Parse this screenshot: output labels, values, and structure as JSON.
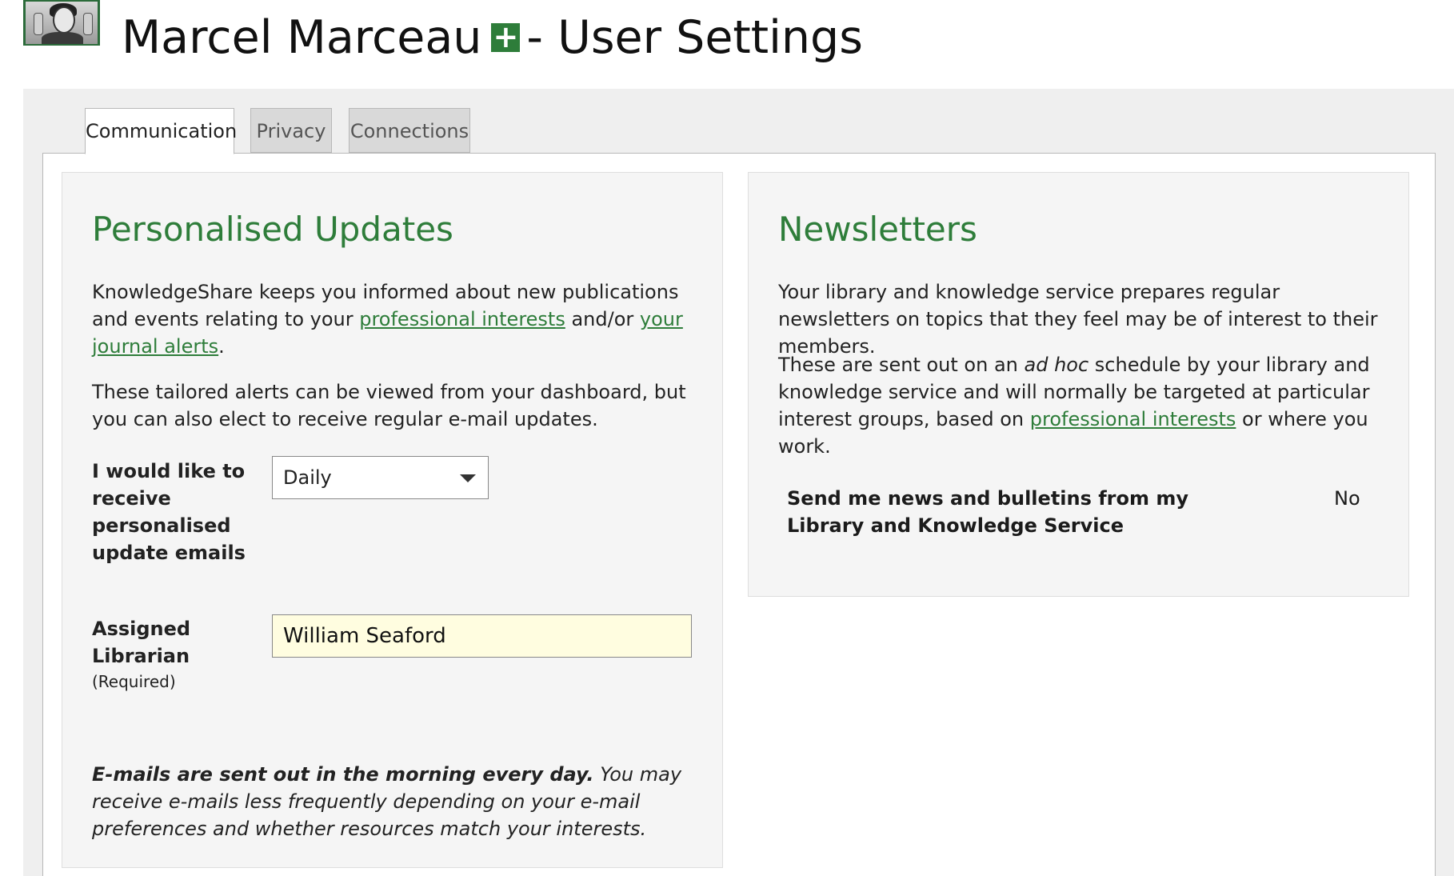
{
  "header": {
    "name": "Marcel Marceau",
    "suffix": "- User Settings",
    "plus_symbol": "+"
  },
  "tabs": [
    {
      "label": "Communication",
      "active": true
    },
    {
      "label": "Privacy",
      "active": false
    },
    {
      "label": "Connections",
      "active": false
    }
  ],
  "personalised": {
    "heading": "Personalised Updates",
    "para1_a": "KnowledgeShare keeps you informed about new publications and events relating to your ",
    "para1_link1": "professional interests",
    "para1_b": " and/or ",
    "para1_link2": "your journal alerts",
    "para1_c": ".",
    "para2": "These tailored alerts can be viewed from your dashboard, but you can also elect to receive regular e-mail updates.",
    "frequency_label": "I would like to receive personalised update emails",
    "frequency_value": "Daily",
    "librarian_label": "Assigned Librarian",
    "librarian_required": "(Required)",
    "librarian_value": "William Seaford",
    "note_bold": "E-mails are sent out in the morning every day.",
    "note_rest": " You may receive e-mails less frequently depending on your e-mail preferences and whether resources match your interests."
  },
  "newsletters": {
    "heading": "Newsletters",
    "para1": "Your library and knowledge service prepares regular newsletters on topics that they feel may be of interest to their members.",
    "para2_a": "These are sent out on an ",
    "para2_em": "ad hoc",
    "para2_b": " schedule by your library and knowledge service and will normally be targeted at particular interest groups, based on ",
    "para2_link": "professional interests",
    "para2_c": " or where you work.",
    "bulletin_label": "Send me news and bulletins from my Library and Knowledge Service",
    "bulletin_value": "No"
  },
  "colors": {
    "accent": "#2e7d3a",
    "input_highlight": "#fffde0"
  }
}
